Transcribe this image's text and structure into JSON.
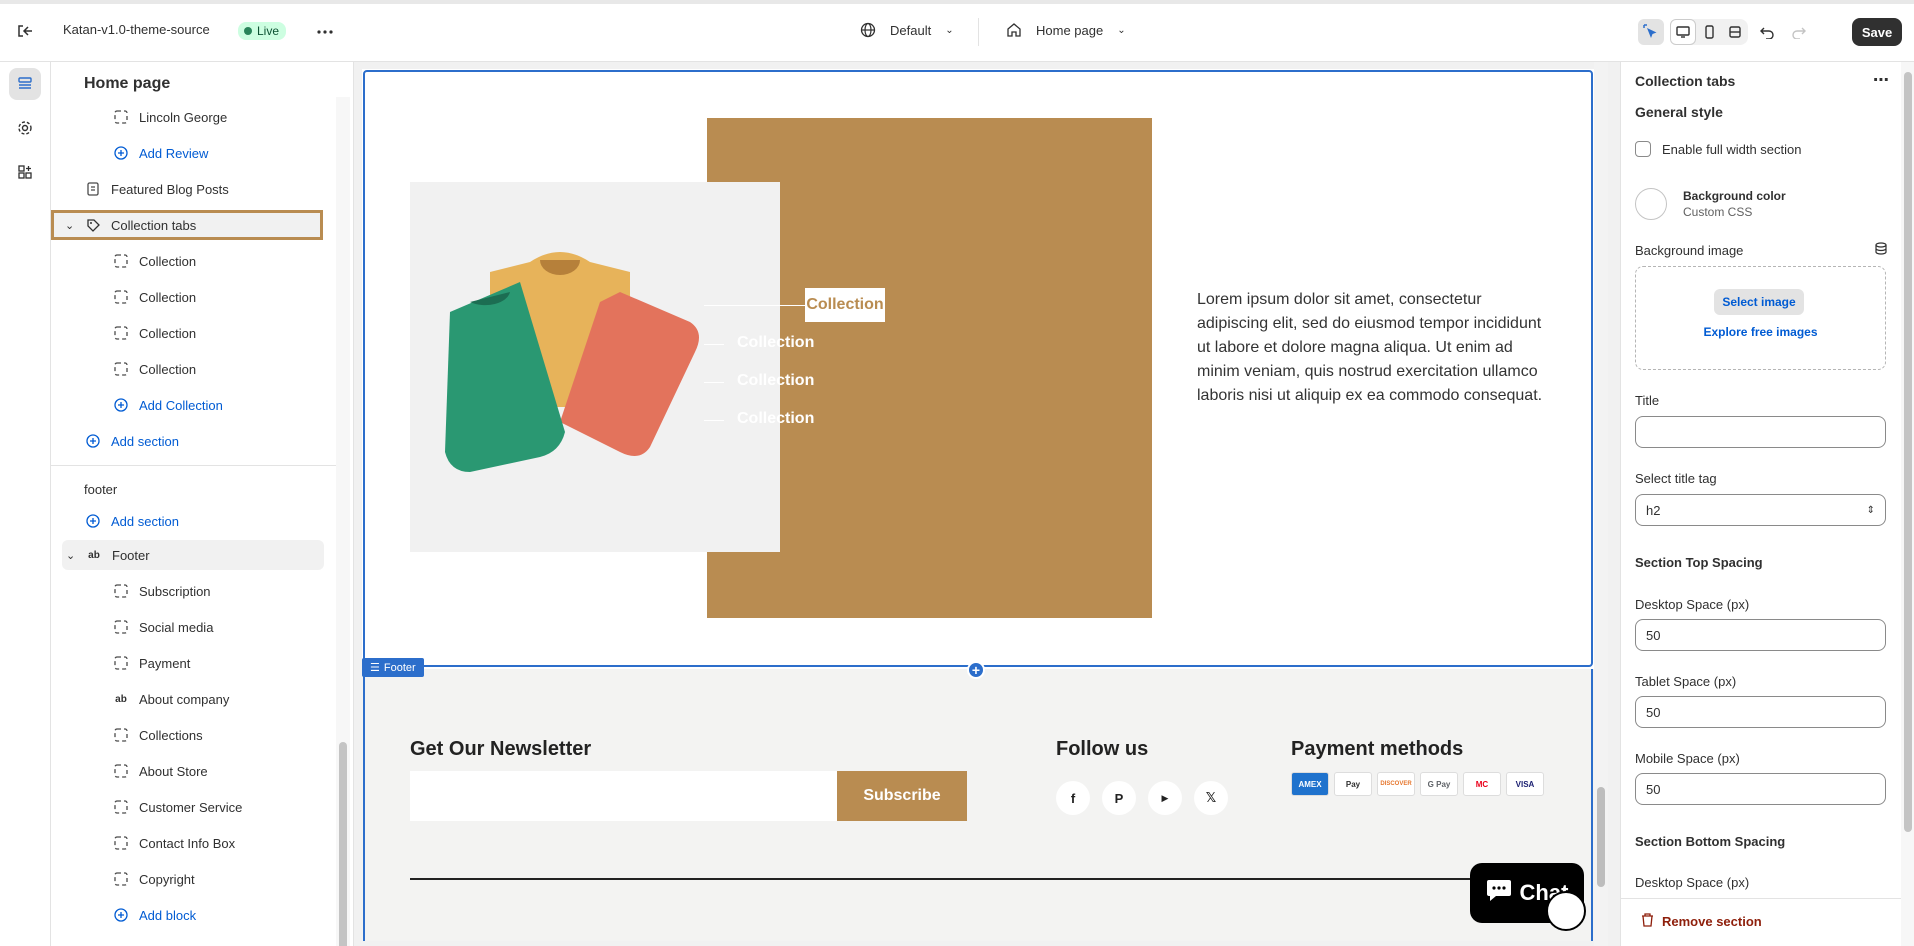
{
  "topbar": {
    "theme_name": "Katan-v1.0-theme-source",
    "live_label": "Live",
    "locale_label": "Default",
    "page_label": "Home page",
    "save_label": "Save"
  },
  "left": {
    "title": "Home page",
    "top_items": [
      {
        "label": "Lincoln George"
      },
      {
        "label": "Add Review"
      },
      {
        "label": "Featured Blog Posts"
      },
      {
        "label": "Collection tabs"
      },
      {
        "label": "Collection"
      },
      {
        "label": "Collection"
      },
      {
        "label": "Collection"
      },
      {
        "label": "Collection"
      },
      {
        "label": "Add Collection"
      },
      {
        "label": "Add section"
      }
    ],
    "footer_group": {
      "title": "footer",
      "add_section": "Add section",
      "footer_label": "Footer",
      "blocks": [
        "Subscription",
        "Social media",
        "Payment",
        "About company",
        "Collections",
        "About Store",
        "Customer Service",
        "Contact Info Box",
        "Copyright"
      ],
      "add_block": "Add block"
    }
  },
  "preview": {
    "tabs": [
      "Collection",
      "Collection",
      "Collection",
      "Collection"
    ],
    "lorem": "Lorem ipsum dolor sit amet, consectetur adipiscing elit, sed do eiusmod tempor incididunt ut labore et dolore magna aliqua. Ut enim ad minim veniam, quis nostrud exercitation ullamco laboris nisi ut aliquip ex ea commodo consequat.",
    "footer_tag": "Footer",
    "newsletter_title": "Get Our Newsletter",
    "subscribe_label": "Subscribe",
    "follow_title": "Follow us",
    "social": [
      "f",
      "P",
      "▶",
      "𝕏"
    ],
    "payment_title": "Payment methods",
    "payments": [
      "AMEX",
      "Pay",
      "DISCOVER",
      "G Pay",
      "MC",
      "VISA"
    ],
    "chat_label": "Chat",
    "accent_color": "#b98c51"
  },
  "right": {
    "section_title": "Collection tabs",
    "general_style": "General style",
    "full_width_label": "Enable full width section",
    "bg_color_label": "Background color",
    "bg_color_sub": "Custom CSS",
    "bg_image_label": "Background image",
    "select_image": "Select image",
    "explore_images": "Explore free images",
    "title_label": "Title",
    "title_value": "",
    "title_tag_label": "Select title tag",
    "title_tag_value": "h2",
    "top_spacing": "Section Top Spacing",
    "desktop_label": "Desktop Space (px)",
    "desktop_value": "50",
    "tablet_label": "Tablet Space (px)",
    "tablet_value": "50",
    "mobile_label": "Mobile Space (px)",
    "mobile_value": "50",
    "bottom_spacing": "Section Bottom Spacing",
    "desktop_bottom_label": "Desktop Space (px)",
    "remove_label": "Remove section"
  }
}
